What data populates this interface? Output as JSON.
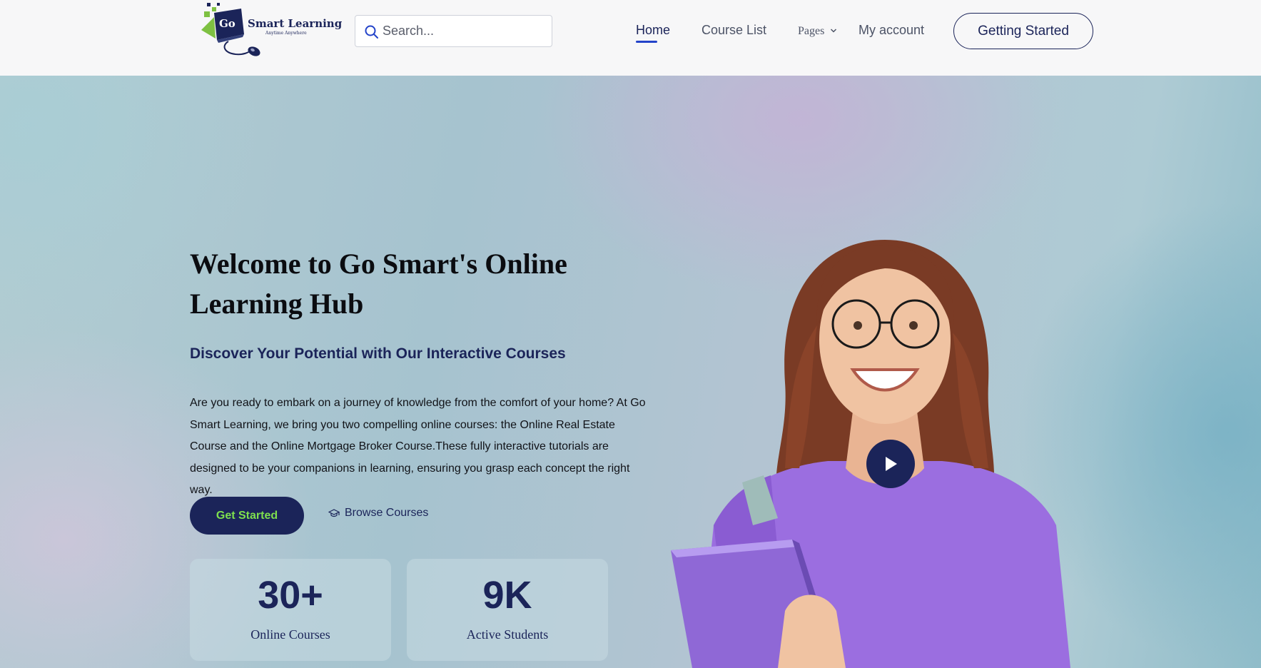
{
  "header": {
    "logo": {
      "go": "Go",
      "title": "Smart Learning",
      "tagline": "Anytime Anywhere"
    },
    "search": {
      "placeholder": "Search..."
    },
    "nav": {
      "home": "Home",
      "course_list": "Course List",
      "pages": "Pages",
      "my_account": "My account"
    },
    "cta_label": "Getting Started"
  },
  "hero": {
    "title": "Welcome to Go Smart's Online Learning Hub",
    "subtitle": "Discover Your Potential with Our Interactive Courses",
    "description": "Are you ready to embark on a journey of knowledge from the comfort of your home? At Go Smart Learning, we bring you two compelling online courses: the Online Real Estate Course and the Online Mortgage Broker Course.These fully interactive tutorials are designed to be your companions in learning, ensuring you grasp each concept the right way.",
    "primary_button": "Get Started",
    "secondary_link": "Browse Courses",
    "stats": [
      {
        "value": "30+",
        "label": "Online Courses"
      },
      {
        "value": "9K",
        "label": "Active Students"
      }
    ]
  },
  "colors": {
    "brand": "#1b2459",
    "accent_green": "#7ee04e",
    "active_underline": "#2343c9",
    "shirt_purple": "#9b6ee0"
  },
  "icons": [
    "search-icon",
    "chevron-down-icon",
    "graduation-cap-icon",
    "play-icon"
  ]
}
